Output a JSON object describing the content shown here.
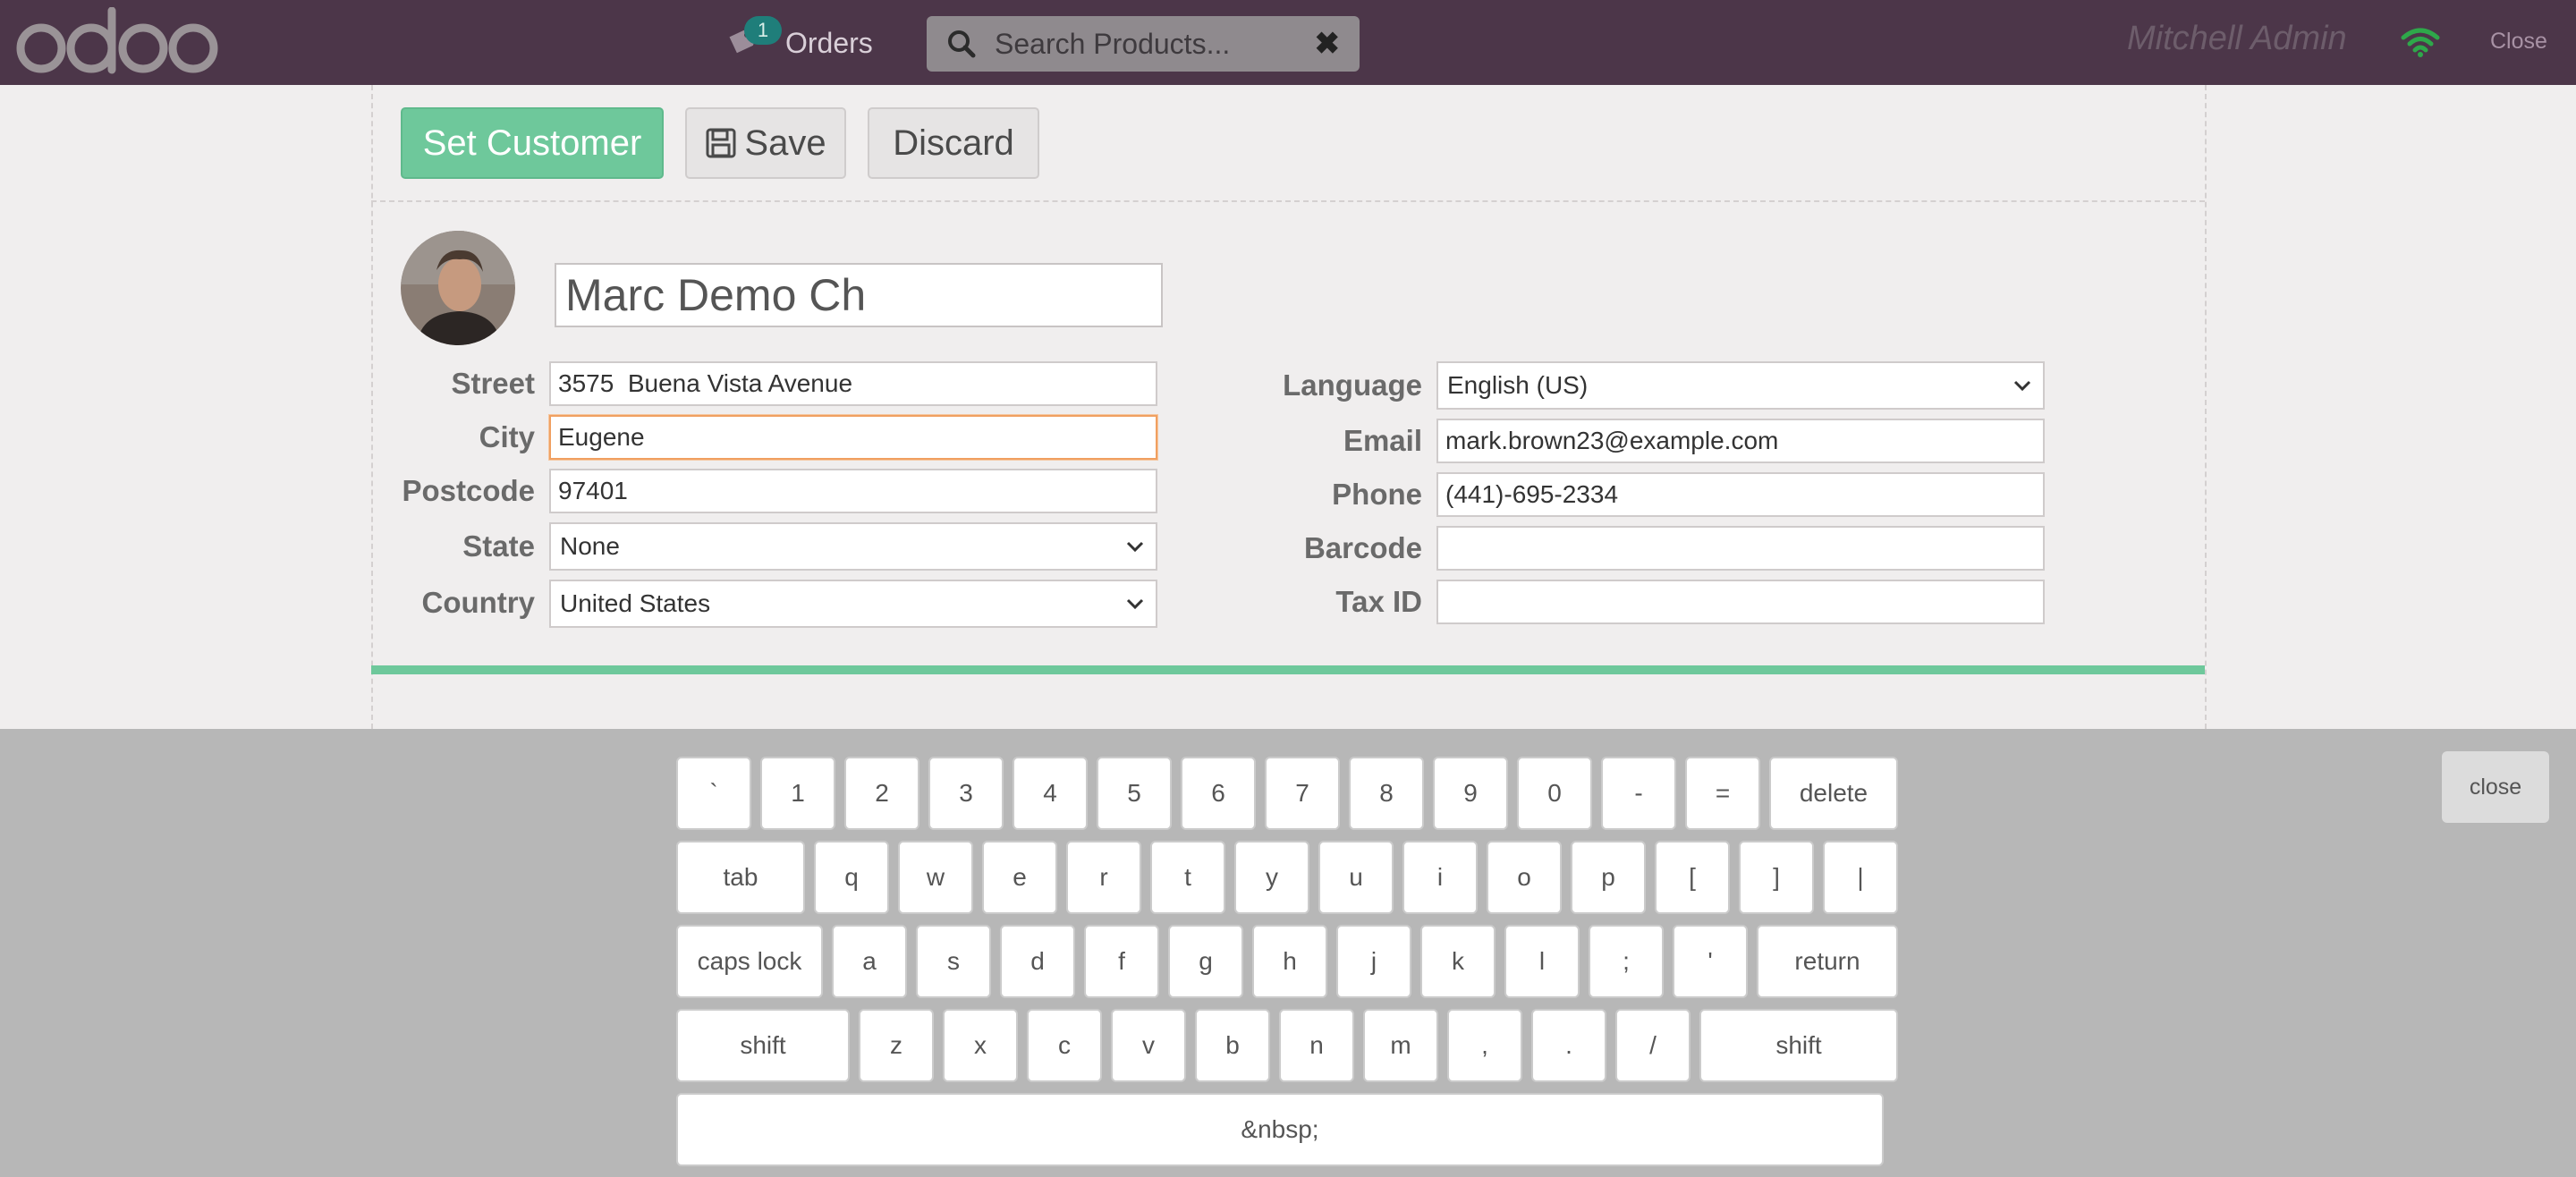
{
  "topbar": {
    "logo_text": "odoo",
    "orders_count": "1",
    "orders_label": "Orders",
    "search_placeholder": "Search Products...",
    "clear_icon": "✖",
    "username": "Mitchell Admin",
    "close_label": "Close",
    "colors": {
      "bar": "#4c3649",
      "badge": "#1f7e7a",
      "wifi": "#2ea84a"
    }
  },
  "toolbar": {
    "set_customer": "Set Customer",
    "save": "Save",
    "discard": "Discard"
  },
  "customer": {
    "name": "Marc Demo Ch",
    "fields_left": [
      {
        "label": "Street",
        "value": "3575  Buena Vista Avenue"
      },
      {
        "label": "City",
        "value": "Eugene"
      },
      {
        "label": "Postcode",
        "value": "97401"
      },
      {
        "label": "State",
        "value": "None"
      },
      {
        "label": "Country",
        "value": "United States"
      }
    ],
    "fields_right": [
      {
        "label": "Language",
        "value": "English (US)"
      },
      {
        "label": "Email",
        "value": "mark.brown23@example.com"
      },
      {
        "label": "Phone",
        "value": "(441)-695-2334"
      },
      {
        "label": "Barcode",
        "value": ""
      },
      {
        "label": "Tax ID",
        "value": ""
      }
    ]
  },
  "keyboard": {
    "row1": [
      "`",
      "1",
      "2",
      "3",
      "4",
      "5",
      "6",
      "7",
      "8",
      "9",
      "0",
      "-",
      "=",
      "delete"
    ],
    "row2": [
      "tab",
      "q",
      "w",
      "e",
      "r",
      "t",
      "y",
      "u",
      "i",
      "o",
      "p",
      "[",
      "]",
      "|"
    ],
    "row3": [
      "caps lock",
      "a",
      "s",
      "d",
      "f",
      "g",
      "h",
      "j",
      "k",
      "l",
      ";",
      "'",
      "return"
    ],
    "row4": [
      "shift",
      "z",
      "x",
      "c",
      "v",
      "b",
      "n",
      "m",
      ",",
      ".",
      "/",
      "shift"
    ],
    "space": "&nbsp;",
    "close": "close"
  },
  "accent_color": "#6ec89b"
}
